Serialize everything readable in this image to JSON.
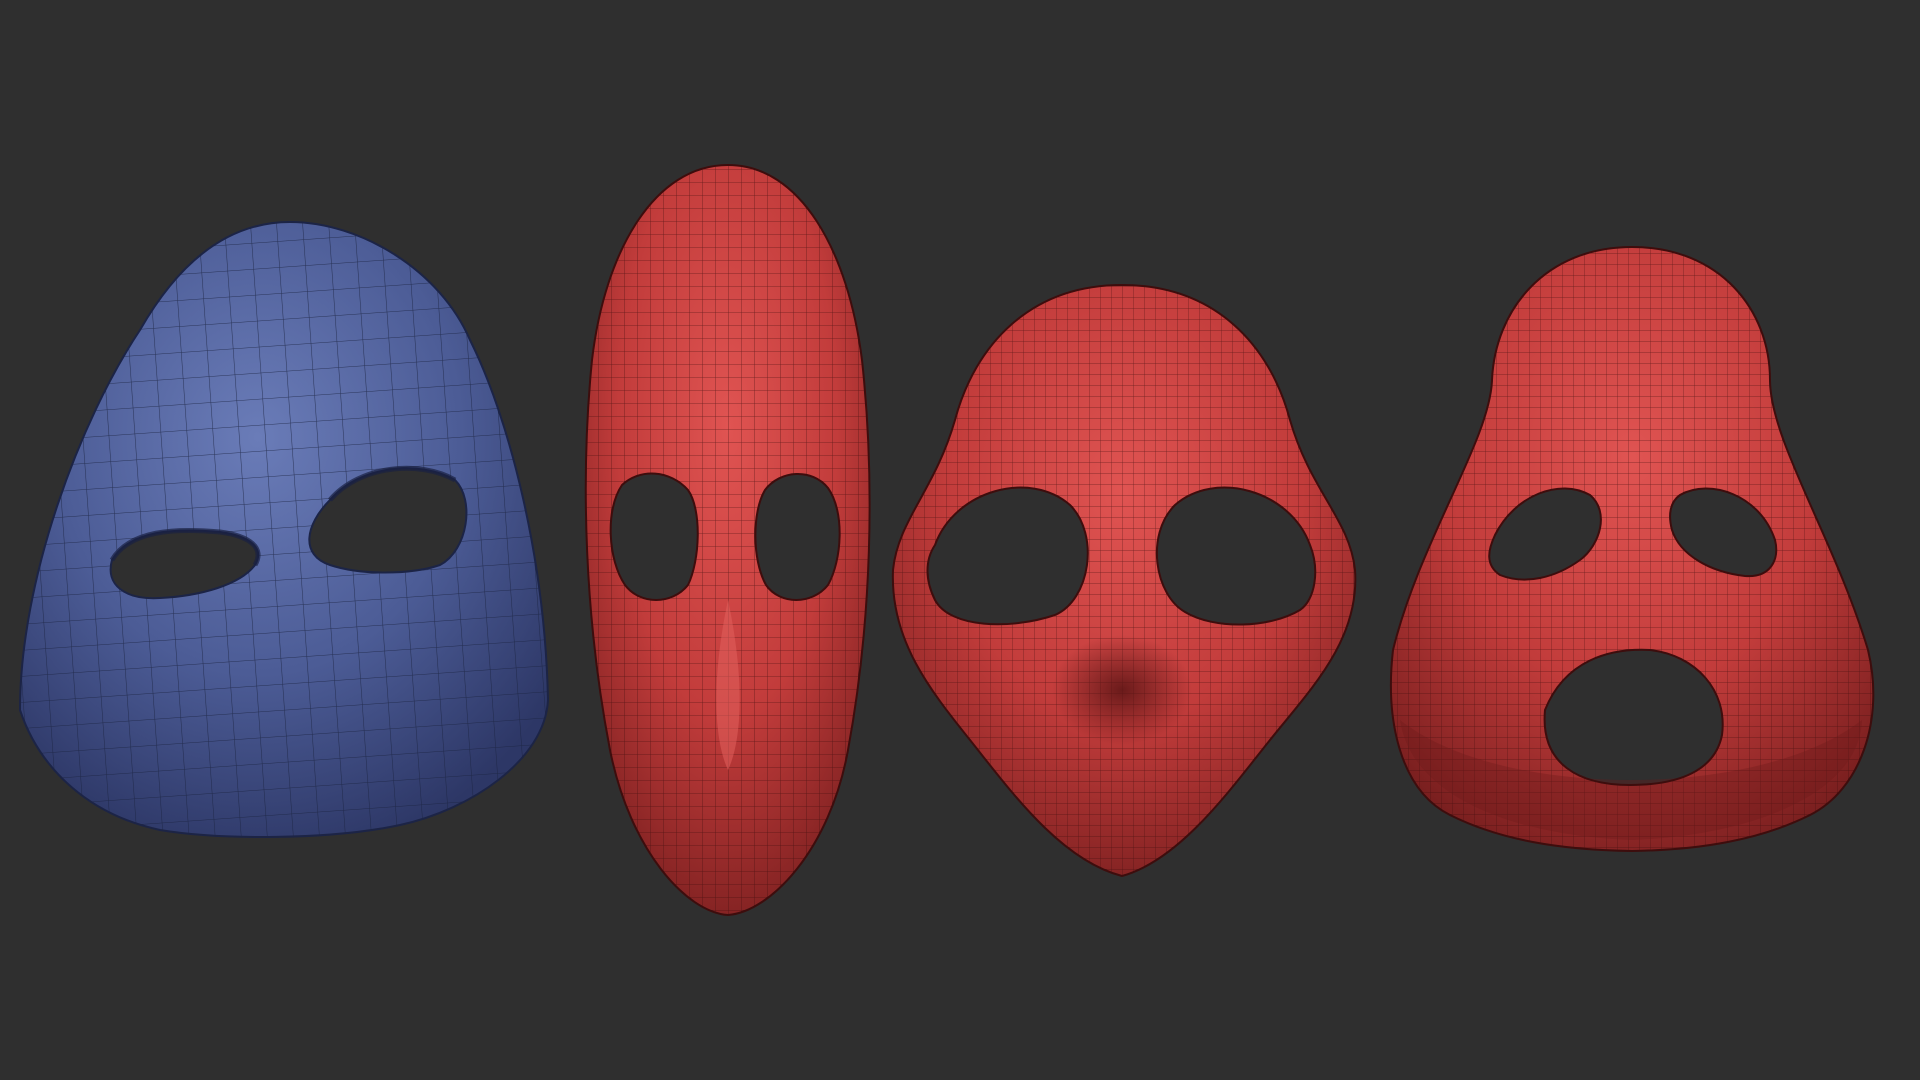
{
  "viewport": {
    "background_color": "#2f2f2f"
  },
  "colors": {
    "mesh_blue": "#4a5a8f",
    "mesh_red": "#c8403f",
    "wire_line": "#1a1a1a"
  },
  "models": [
    {
      "id": "mask-1",
      "color": "mesh_blue"
    },
    {
      "id": "mask-2",
      "color": "mesh_red"
    },
    {
      "id": "mask-3",
      "color": "mesh_red"
    },
    {
      "id": "mask-4",
      "color": "mesh_red"
    }
  ]
}
